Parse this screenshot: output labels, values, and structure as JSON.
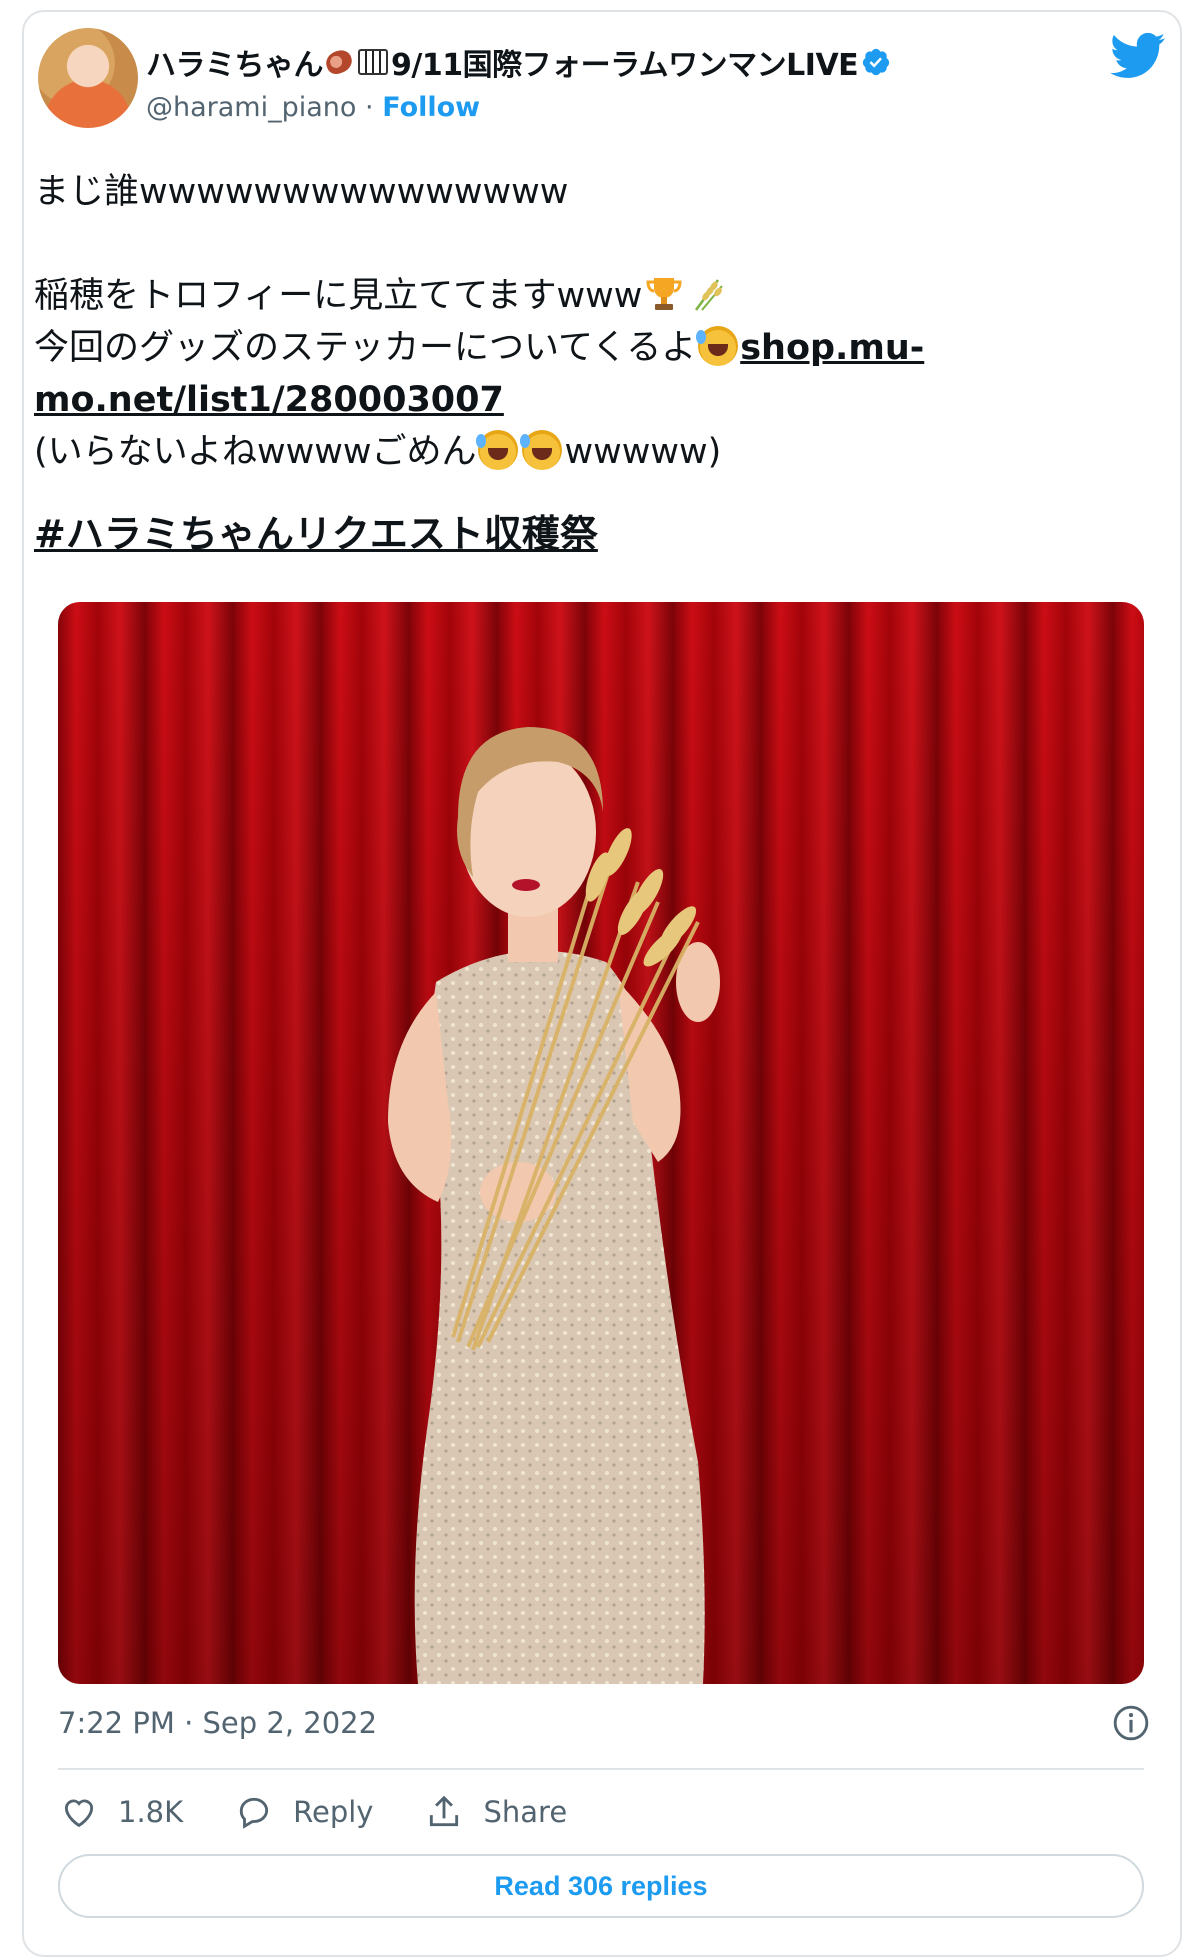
{
  "author": {
    "display_name_prefix": "ハラミちゃん",
    "display_name_suffix": "9/11国際フォーラムワンマンLIVE",
    "name_icons": [
      "meat-icon",
      "piano-icon",
      "verified-badge-icon"
    ],
    "handle": "@harami_piano",
    "separator": "·",
    "follow_label": "Follow"
  },
  "tweet": {
    "line1": "まじ誰wwwwwwwwwwwwwww",
    "line2": "稲穂をトロフィーに見立ててますwww",
    "line2_emojis": [
      "trophy-emoji",
      "rice-emoji"
    ],
    "line3_text": "今回のグッズのステッカーについてくるよ",
    "line3_link": "shop.mu-",
    "line4_link": "mo.net/list1/280003007",
    "line5_prefix": "(いらないよねwwwwごめん",
    "line5_suffix": "wwwww)",
    "hashtag": "#ハラミちゃんリクエスト収穫祭"
  },
  "media": {
    "icon": "photo-woman-holding-rice-red-curtain"
  },
  "footer": {
    "timestamp": "7:22 PM · Sep 2, 2022",
    "like_count": "1.8K",
    "reply_label": "Reply",
    "share_label": "Share",
    "read_replies_label": "Read 306 replies"
  },
  "colors": {
    "accent": "#1d9bf0",
    "text": "#0f1419",
    "muted": "#536471",
    "border": "#dfe3e6"
  }
}
